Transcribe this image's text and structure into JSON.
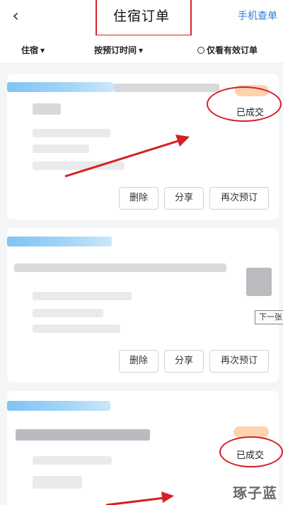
{
  "header": {
    "back_icon": "chevron-left-icon",
    "title": "住宿订单",
    "right_link": "手机查单"
  },
  "filters": {
    "stay": "住宿",
    "sort": "按预订时间",
    "valid_only": "仅看有效订单"
  },
  "orders": [
    {
      "status": "已成交",
      "buttons": [
        "删除",
        "分享",
        "再次预订"
      ]
    },
    {
      "status": "",
      "buttons": [
        "删除",
        "分享",
        "再次预订"
      ]
    },
    {
      "status": "已成交",
      "buttons": []
    }
  ],
  "tooltip": "下一张",
  "watermark": "琢子蓝",
  "colors": {
    "accent_blue": "#2f7fd8",
    "annotation_red": "#d41f26",
    "background": "#f4f5f7"
  }
}
